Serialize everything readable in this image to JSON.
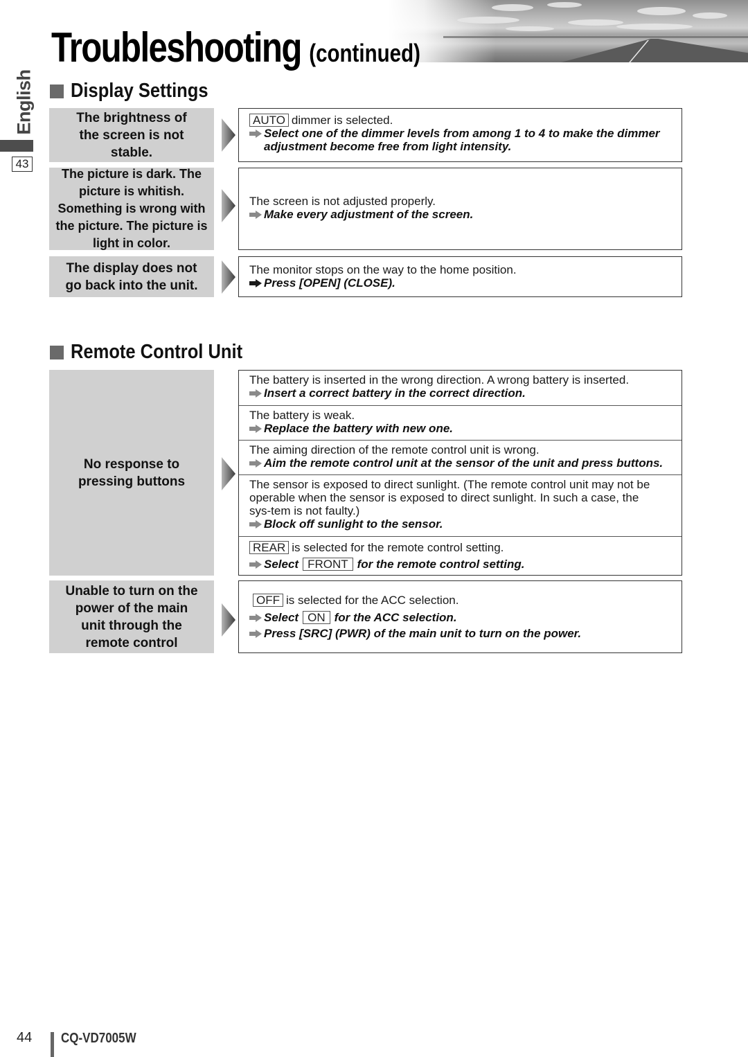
{
  "header": {
    "title": "Troubleshooting",
    "title_suffix": "(continued)"
  },
  "side_tab": {
    "language": "English",
    "section_number": "43"
  },
  "sections": [
    {
      "heading": "Display Settings",
      "rows": [
        {
          "symptom": "The brightness of the screen is not stable.",
          "entries": [
            {
              "key": "AUTO",
              "cause": "dimmer is selected.",
              "fix": "Select one of the dimmer levels from among 1 to 4 to make the dimmer",
              "fix_cont": "adjustment become free from light intensity."
            }
          ]
        },
        {
          "symptom": "The picture is dark. The picture is whitish. Something is wrong with the picture. The picture is light in color.",
          "entries": [
            {
              "cause": "The screen is not adjusted properly.",
              "fix": "Make every adjustment of the screen."
            }
          ]
        },
        {
          "symptom": "The display does not go back into the unit.",
          "entries": [
            {
              "cause": "The monitor stops on the way to the home position.",
              "fix": "Press [OPEN] (CLOSE)."
            }
          ]
        }
      ]
    },
    {
      "heading": "Remote Control Unit",
      "rows": [
        {
          "symptom": "No response to pressing buttons",
          "entries": [
            {
              "cause": "The battery is inserted in the wrong direction. A wrong battery is inserted.",
              "fix": "Insert a correct battery in the correct direction."
            },
            {
              "cause": "The battery is weak.",
              "fix": "Replace the battery with new one."
            },
            {
              "cause": "The aiming direction of the remote control unit is wrong.",
              "fix": "Aim the remote control unit at the sensor of the unit and press buttons."
            },
            {
              "cause": "The sensor is exposed to direct sunlight. (The remote control unit may not be operable when the sensor is exposed to direct sunlight. In such a case, the sys-tem is not faulty.)",
              "fix": "Block off sunlight to the sensor."
            },
            {
              "key": "REAR",
              "cause": "is selected for the remote control setting.",
              "fix_pre": "Select",
              "fix_key": "FRONT",
              "fix": "for the remote control setting."
            }
          ]
        },
        {
          "symptom": "Unable to turn on the power of the main unit through the remote control",
          "entries": [
            {
              "key": "OFF",
              "cause": "is selected for the ACC selection.",
              "fix_pre": "Select",
              "fix_key": "ON",
              "fix": "for the ACC selection.",
              "fix2": "Press [SRC] (PWR) of the main unit to turn on the power."
            }
          ]
        }
      ]
    }
  ],
  "footer": {
    "page_number": "44",
    "model": "CQ-VD7005W"
  }
}
